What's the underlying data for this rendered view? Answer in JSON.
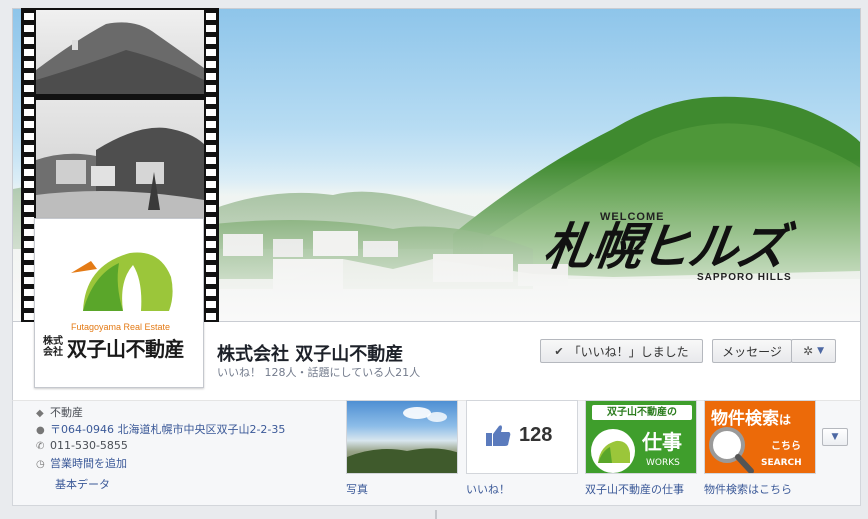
{
  "cover": {
    "welcome": "WELCOME",
    "title": "札幌ヒルズ",
    "subtitle": "SAPPORO HILLS"
  },
  "logo": {
    "english": "Futagoyama Real Estate",
    "kaisha": "株式会社",
    "name": "双子山不動産"
  },
  "page": {
    "name": "株式会社 双子山不動産",
    "stats": "いいね！ 128人・話題にしている人21人"
  },
  "actions": {
    "liked_label": "「いいね！」しました",
    "message_label": "メッセージ"
  },
  "info": {
    "rows": [
      {
        "icon": "tag-icon",
        "text": "不動産"
      },
      {
        "icon": "map-pin-icon",
        "text": "〒064-0946 北海道札幌市中央区双子山2-2-35"
      },
      {
        "icon": "phone-icon",
        "text": "011-530-5855"
      },
      {
        "icon": "clock-icon",
        "text": "営業時間を追加"
      }
    ],
    "basic_data": "基本データ"
  },
  "apps": {
    "photo_label": "写真",
    "likes_count": "128",
    "likes_label": "いいね！",
    "works_top": "双子山不動産の",
    "works_big": "仕事",
    "works_en": "WORKS",
    "works_label": "双子山不動産の仕事",
    "search_big": "物件検索",
    "search_ha": "は",
    "search_kochira": "こちら",
    "search_en": "SEARCH",
    "search_label": "物件検索はこちら"
  },
  "colors": {
    "link": "#3b5998",
    "works_green": "#3f9e2c",
    "search_orange": "#ec6a09",
    "logo_orange": "#e47b16"
  }
}
